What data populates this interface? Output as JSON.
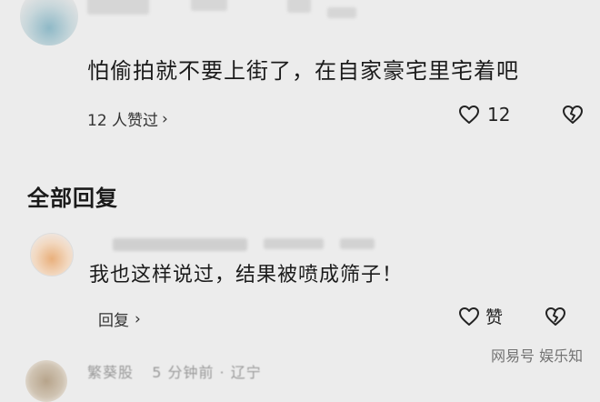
{
  "top_comment": {
    "text": "怕偷拍就不要上街了，在自家豪宅里宅着吧",
    "likers_label": "12 人赞过",
    "like_count": "12"
  },
  "section": {
    "title": "全部回复"
  },
  "reply": {
    "text": "我也这样说过，结果被喷成筛子！",
    "reply_label": "回复",
    "like_label": "赞"
  },
  "bottom": {
    "username": "繁葵股",
    "meta": "5 分钟前 · 辽宁"
  },
  "watermark": "网易号 娱乐知"
}
